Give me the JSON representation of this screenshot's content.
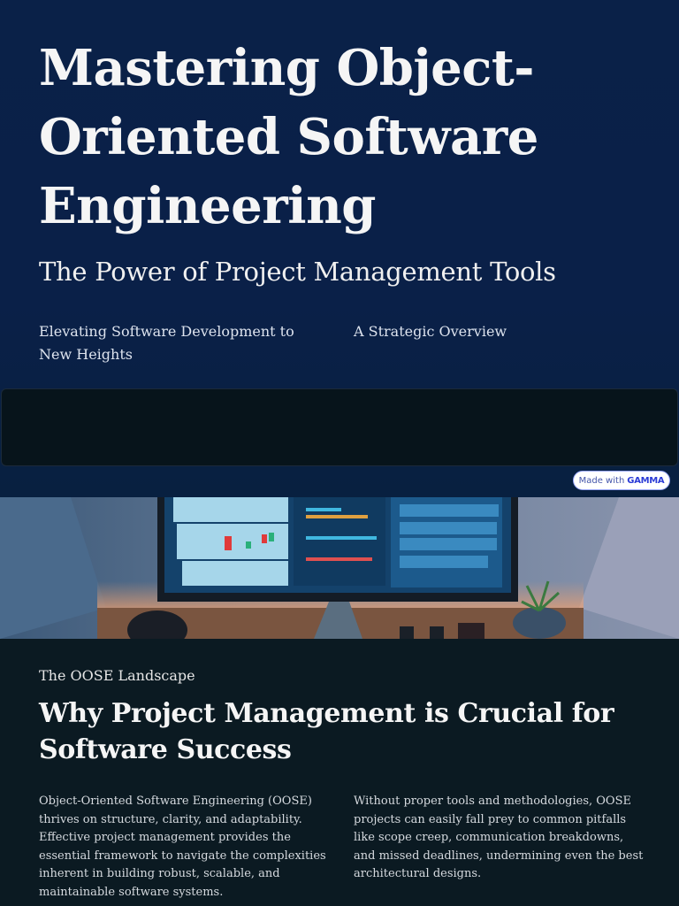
{
  "hero": {
    "title": "Mastering Object-Oriented Software Engineering",
    "subtitle": "The Power of Project Management Tools",
    "tagline_left": "Elevating Software Development to New Heights",
    "tagline_right": "A Strategic Overview"
  },
  "badge": {
    "prefix": "Made with",
    "brand": "GAMMA"
  },
  "section": {
    "kicker": "The OOSE Landscape",
    "heading": "Why Project Management is Crucial for Software Success",
    "paragraph_left": "Object-Oriented Software Engineering (OOSE) thrives on structure, clarity, and adaptability. Effective project management provides the essential framework to navigate the complexities inherent in building robust, scalable, and maintainable software systems.",
    "paragraph_right": "Without proper tools and methodologies, OOSE projects can easily fall prey to common pitfalls like scope creep, communication breakdowns, and missed deadlines, undermining even the best architectural designs."
  },
  "colors": {
    "hero_bg": "#0a2148",
    "lower_bg": "#0b1a22",
    "badge_brand": "#2b3bd6"
  }
}
